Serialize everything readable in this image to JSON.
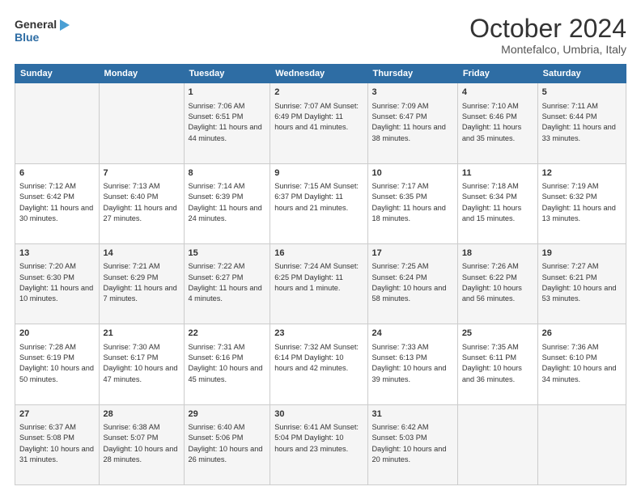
{
  "logo": {
    "line1": "General",
    "line2": "Blue"
  },
  "title": "October 2024",
  "subtitle": "Montefalco, Umbria, Italy",
  "days_of_week": [
    "Sunday",
    "Monday",
    "Tuesday",
    "Wednesday",
    "Thursday",
    "Friday",
    "Saturday"
  ],
  "weeks": [
    [
      {
        "day": "",
        "content": ""
      },
      {
        "day": "",
        "content": ""
      },
      {
        "day": "1",
        "content": "Sunrise: 7:06 AM\nSunset: 6:51 PM\nDaylight: 11 hours and 44 minutes."
      },
      {
        "day": "2",
        "content": "Sunrise: 7:07 AM\nSunset: 6:49 PM\nDaylight: 11 hours and 41 minutes."
      },
      {
        "day": "3",
        "content": "Sunrise: 7:09 AM\nSunset: 6:47 PM\nDaylight: 11 hours and 38 minutes."
      },
      {
        "day": "4",
        "content": "Sunrise: 7:10 AM\nSunset: 6:46 PM\nDaylight: 11 hours and 35 minutes."
      },
      {
        "day": "5",
        "content": "Sunrise: 7:11 AM\nSunset: 6:44 PM\nDaylight: 11 hours and 33 minutes."
      }
    ],
    [
      {
        "day": "6",
        "content": "Sunrise: 7:12 AM\nSunset: 6:42 PM\nDaylight: 11 hours and 30 minutes."
      },
      {
        "day": "7",
        "content": "Sunrise: 7:13 AM\nSunset: 6:40 PM\nDaylight: 11 hours and 27 minutes."
      },
      {
        "day": "8",
        "content": "Sunrise: 7:14 AM\nSunset: 6:39 PM\nDaylight: 11 hours and 24 minutes."
      },
      {
        "day": "9",
        "content": "Sunrise: 7:15 AM\nSunset: 6:37 PM\nDaylight: 11 hours and 21 minutes."
      },
      {
        "day": "10",
        "content": "Sunrise: 7:17 AM\nSunset: 6:35 PM\nDaylight: 11 hours and 18 minutes."
      },
      {
        "day": "11",
        "content": "Sunrise: 7:18 AM\nSunset: 6:34 PM\nDaylight: 11 hours and 15 minutes."
      },
      {
        "day": "12",
        "content": "Sunrise: 7:19 AM\nSunset: 6:32 PM\nDaylight: 11 hours and 13 minutes."
      }
    ],
    [
      {
        "day": "13",
        "content": "Sunrise: 7:20 AM\nSunset: 6:30 PM\nDaylight: 11 hours and 10 minutes."
      },
      {
        "day": "14",
        "content": "Sunrise: 7:21 AM\nSunset: 6:29 PM\nDaylight: 11 hours and 7 minutes."
      },
      {
        "day": "15",
        "content": "Sunrise: 7:22 AM\nSunset: 6:27 PM\nDaylight: 11 hours and 4 minutes."
      },
      {
        "day": "16",
        "content": "Sunrise: 7:24 AM\nSunset: 6:25 PM\nDaylight: 11 hours and 1 minute."
      },
      {
        "day": "17",
        "content": "Sunrise: 7:25 AM\nSunset: 6:24 PM\nDaylight: 10 hours and 58 minutes."
      },
      {
        "day": "18",
        "content": "Sunrise: 7:26 AM\nSunset: 6:22 PM\nDaylight: 10 hours and 56 minutes."
      },
      {
        "day": "19",
        "content": "Sunrise: 7:27 AM\nSunset: 6:21 PM\nDaylight: 10 hours and 53 minutes."
      }
    ],
    [
      {
        "day": "20",
        "content": "Sunrise: 7:28 AM\nSunset: 6:19 PM\nDaylight: 10 hours and 50 minutes."
      },
      {
        "day": "21",
        "content": "Sunrise: 7:30 AM\nSunset: 6:17 PM\nDaylight: 10 hours and 47 minutes."
      },
      {
        "day": "22",
        "content": "Sunrise: 7:31 AM\nSunset: 6:16 PM\nDaylight: 10 hours and 45 minutes."
      },
      {
        "day": "23",
        "content": "Sunrise: 7:32 AM\nSunset: 6:14 PM\nDaylight: 10 hours and 42 minutes."
      },
      {
        "day": "24",
        "content": "Sunrise: 7:33 AM\nSunset: 6:13 PM\nDaylight: 10 hours and 39 minutes."
      },
      {
        "day": "25",
        "content": "Sunrise: 7:35 AM\nSunset: 6:11 PM\nDaylight: 10 hours and 36 minutes."
      },
      {
        "day": "26",
        "content": "Sunrise: 7:36 AM\nSunset: 6:10 PM\nDaylight: 10 hours and 34 minutes."
      }
    ],
    [
      {
        "day": "27",
        "content": "Sunrise: 6:37 AM\nSunset: 5:08 PM\nDaylight: 10 hours and 31 minutes."
      },
      {
        "day": "28",
        "content": "Sunrise: 6:38 AM\nSunset: 5:07 PM\nDaylight: 10 hours and 28 minutes."
      },
      {
        "day": "29",
        "content": "Sunrise: 6:40 AM\nSunset: 5:06 PM\nDaylight: 10 hours and 26 minutes."
      },
      {
        "day": "30",
        "content": "Sunrise: 6:41 AM\nSunset: 5:04 PM\nDaylight: 10 hours and 23 minutes."
      },
      {
        "day": "31",
        "content": "Sunrise: 6:42 AM\nSunset: 5:03 PM\nDaylight: 10 hours and 20 minutes."
      },
      {
        "day": "",
        "content": ""
      },
      {
        "day": "",
        "content": ""
      }
    ]
  ]
}
